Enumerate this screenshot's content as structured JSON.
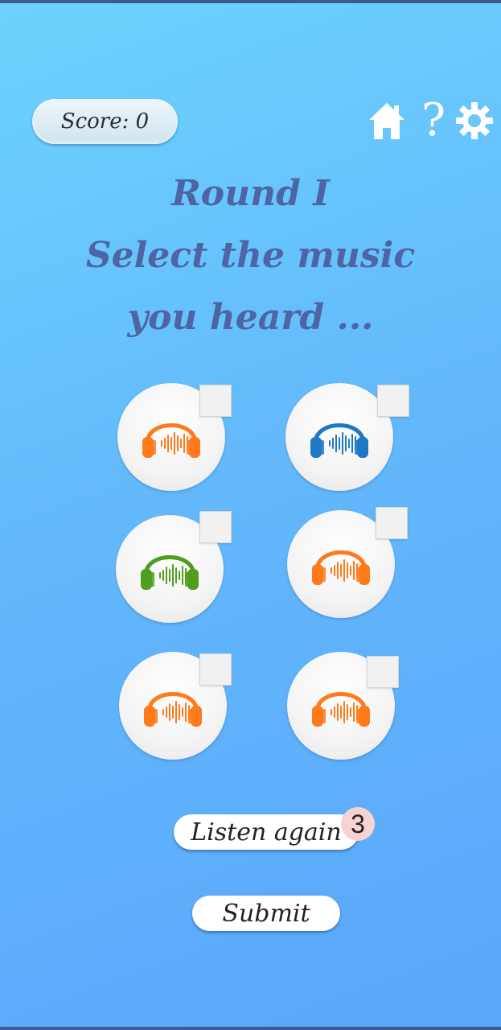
{
  "score": {
    "label": "Score: 0"
  },
  "nav": {
    "home_icon": "home-icon",
    "help_label": "?",
    "settings_icon": "gear-icon"
  },
  "title": {
    "line1": "Round I",
    "line2": "Select the music",
    "line3": "you heard ..."
  },
  "options": [
    {
      "color": "#ff7a1a",
      "icon": "headphones-icon",
      "checked": false
    },
    {
      "color": "#1f78c6",
      "icon": "headphones-icon",
      "checked": false
    },
    {
      "color": "#4f9e1d",
      "icon": "headphones-icon",
      "checked": false
    },
    {
      "color": "#ff7a1a",
      "icon": "headphones-icon",
      "checked": false
    },
    {
      "color": "#ff7a1a",
      "icon": "headphones-icon",
      "checked": false
    },
    {
      "color": "#ff7a1a",
      "icon": "headphones-icon",
      "checked": false
    }
  ],
  "actions": {
    "listen_again": "Listen again",
    "listen_again_count": "3",
    "submit": "Submit"
  },
  "colors": {
    "title": "#4e64a4",
    "background_top": "#6dd3fd",
    "background_bottom": "#5aa6fb"
  }
}
